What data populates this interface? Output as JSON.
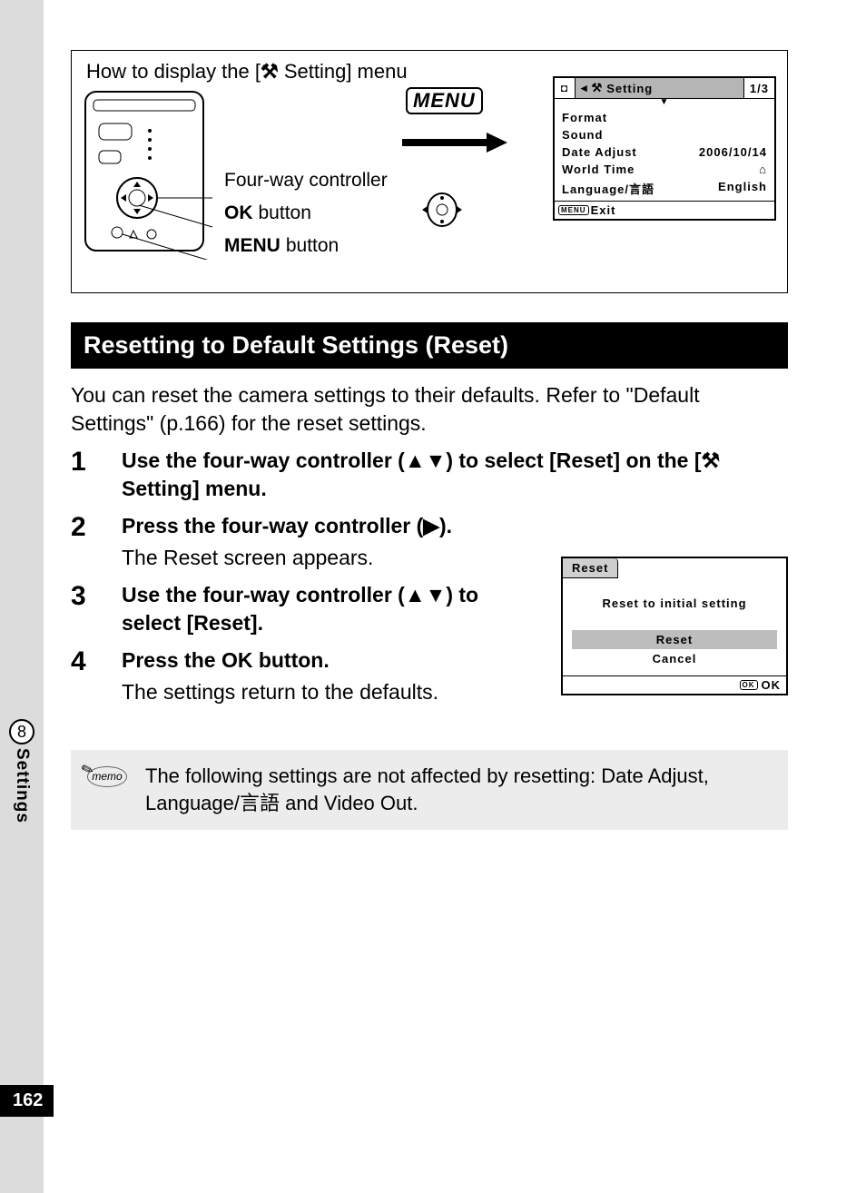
{
  "howto": {
    "title_prefix": "How to display the [",
    "title_suffix": " Setting] menu",
    "label_fourway": "Four-way controller",
    "label_ok_prefix": "OK",
    "label_ok_suffix": " button",
    "label_menu_prefix": "MENU",
    "label_menu_suffix": " button",
    "menu_button": "MENU"
  },
  "setting_screen": {
    "tab_title": "Setting",
    "page": "1/3",
    "items": [
      {
        "label": "Format",
        "value": ""
      },
      {
        "label": "Sound",
        "value": ""
      },
      {
        "label": "Date Adjust",
        "value": "2006/10/14"
      },
      {
        "label": "World Time",
        "value": "⌂"
      },
      {
        "label": "Language/言語",
        "value": "English"
      }
    ],
    "exit": "Exit"
  },
  "section_title": "Resetting to Default Settings (Reset)",
  "intro": "You can reset the camera settings to their defaults. Refer to \"Default Settings\" (p.166) for the reset settings.",
  "steps": [
    {
      "num": "1",
      "head": "Use the four-way controller (▲▼) to select [Reset] on the [⚒ Setting] menu."
    },
    {
      "num": "2",
      "head": "Press the four-way controller (▶).",
      "detail": "The Reset screen appears."
    },
    {
      "num": "3",
      "head": "Use the four-way controller (▲▼) to select [Reset]."
    },
    {
      "num": "4",
      "head": "Press the OK button.",
      "detail": "The settings return to the defaults."
    }
  ],
  "reset_screen": {
    "tab": "Reset",
    "title": "Reset to initial setting",
    "opt_selected": "Reset",
    "opt_cancel": "Cancel",
    "ok": "OK"
  },
  "memo": {
    "label": "memo",
    "text": "The following settings are not affected by resetting: Date Adjust, Language/言語 and Video Out."
  },
  "side": {
    "section_number": "8",
    "section_label": "Settings"
  },
  "page_number": "162"
}
